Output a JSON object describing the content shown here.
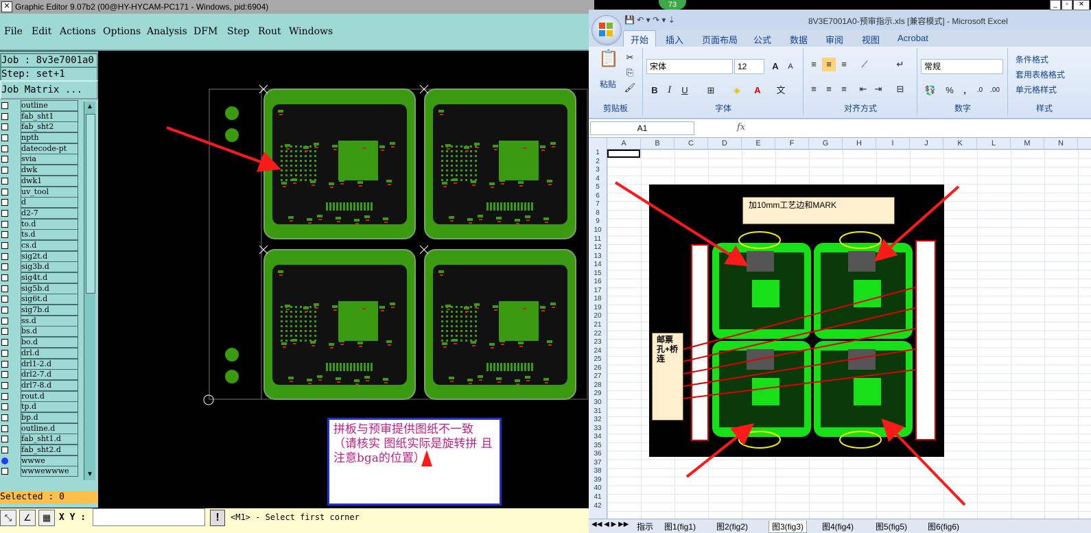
{
  "graphic_editor": {
    "title": "Graphic Editor 9.07b2 (00@HY-HYCAM-PC171 - Windows, pid:6904)",
    "menu": [
      "File",
      "Edit",
      "Actions",
      "Options",
      "Analysis",
      "DFM",
      "Step",
      "Rout",
      "Windows"
    ],
    "job_label": "Job : 8v3e7001a0",
    "step_label": "Step: set+1",
    "job_matrix_label": "Job Matrix ...",
    "layers": [
      "outline",
      "fab_sht1",
      "fab_sht2",
      "npth",
      "datecode-pt",
      "svia",
      "dwk",
      "dwk1",
      "uv_tool",
      "d",
      "d2-7",
      "to.d",
      "ts.d",
      "cs.d",
      "sig2t.d",
      "sig3b.d",
      "sig4t.d",
      "sig5b.d",
      "sig6t.d",
      "sig7b.d",
      "ss.d",
      "bs.d",
      "bo.d",
      "drl.d",
      "drl1-2.d",
      "drl2-7.d",
      "drl7-8.d",
      "rout.d",
      "tp.d",
      "bp.d",
      "outline.d",
      "fab_sht1.d",
      "fab_sht2.d",
      "wwwe",
      "wwwewwwe"
    ],
    "active_layer_index": 33,
    "selected_label": "Selected : 0",
    "xy_label": "X Y :",
    "xy_value": "",
    "status_message": "<M1> - Select first corner",
    "note_text": "拼板与预审提供图纸不一致（请核实   图纸实际是旋转拼    且注意bga的位置）"
  },
  "excel": {
    "title": "8V3E7001A0-预审指示.xls  [兼容模式] - Microsoft Excel",
    "badge": "73",
    "tabs": [
      "开始",
      "插入",
      "页面布局",
      "公式",
      "数据",
      "审阅",
      "视图",
      "Acrobat"
    ],
    "active_tab": "开始",
    "ribbon": {
      "paste": "粘贴",
      "clipboard": "剪贴板",
      "font_name": "宋体",
      "font_size": "12",
      "font_group": "字体",
      "align_group": "对齐方式",
      "number_format": "常规",
      "number_group": "数字",
      "conditional": "条件格式",
      "table_format": "套用表格格式",
      "cell_style": "单元格样式",
      "style_group": "样式"
    },
    "name_box": "A1",
    "fx": "fx",
    "columns": [
      "A",
      "B",
      "C",
      "D",
      "E",
      "F",
      "G",
      "H",
      "I",
      "J",
      "K",
      "L",
      "M",
      "N"
    ],
    "rows": [
      "1",
      "2",
      "3",
      "4",
      "5",
      "6",
      "7",
      "8",
      "9",
      "10",
      "11",
      "12",
      "13",
      "14",
      "15",
      "16",
      "17",
      "18",
      "19",
      "20",
      "21",
      "22",
      "23",
      "24",
      "25",
      "26",
      "27",
      "28",
      "29",
      "30",
      "31",
      "32",
      "33",
      "34",
      "35",
      "36",
      "37",
      "38",
      "39",
      "40",
      "41",
      "42"
    ],
    "image_note_top": "加10mm工艺边和MARK",
    "image_note_left": "邮票孔+桥连",
    "sheet_tabs": [
      "指示",
      "图1(fig1)",
      "图2(fig2)",
      "图3(fig3)",
      "图4(fig4)",
      "图5(fig5)",
      "图6(fig6)"
    ],
    "active_sheet": "图3(fig3)"
  },
  "colors": {
    "teal_panel": "#9ed9d6",
    "pcb_green": "#3a9a10",
    "annotation_red": "#ff1a1a",
    "note_magenta": "#c0208a"
  }
}
